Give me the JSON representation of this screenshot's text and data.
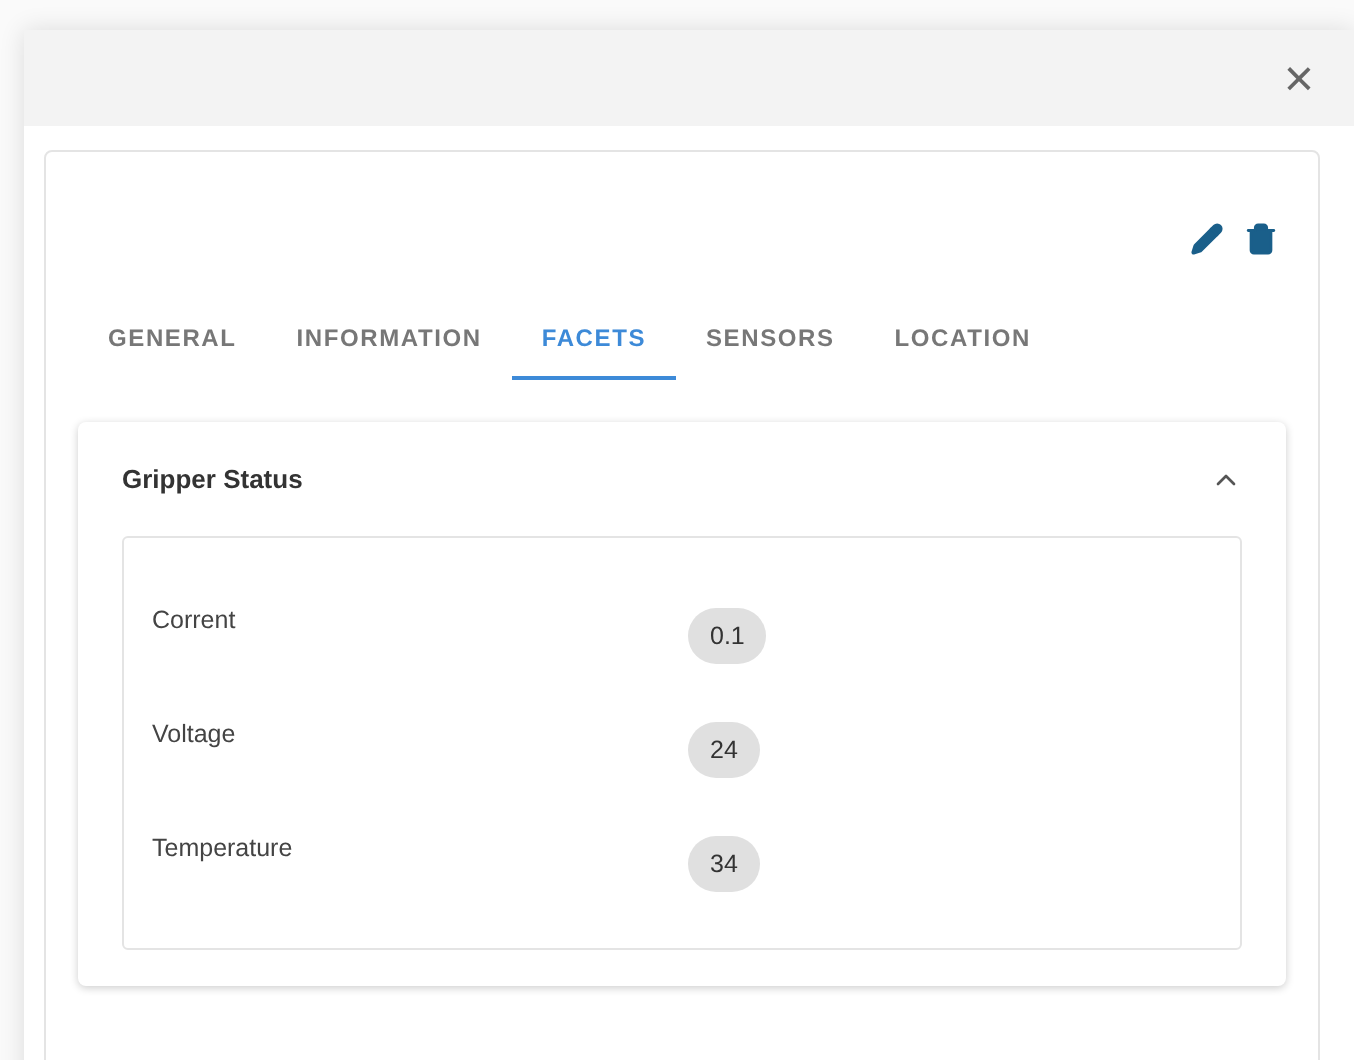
{
  "dialog": {
    "close_label": "×"
  },
  "tabs": [
    {
      "label": "GENERAL",
      "selected": false
    },
    {
      "label": "INFORMATION",
      "selected": false
    },
    {
      "label": "FACETS",
      "selected": true
    },
    {
      "label": "SENSORS",
      "selected": false
    },
    {
      "label": "LOCATION",
      "selected": false
    }
  ],
  "panel": {
    "title": "Gripper Status",
    "expanded": true,
    "rows": [
      {
        "label": "Corrent",
        "value": "0.1"
      },
      {
        "label": "Voltage",
        "value": "24"
      },
      {
        "label": "Temperature",
        "value": "34"
      }
    ]
  }
}
